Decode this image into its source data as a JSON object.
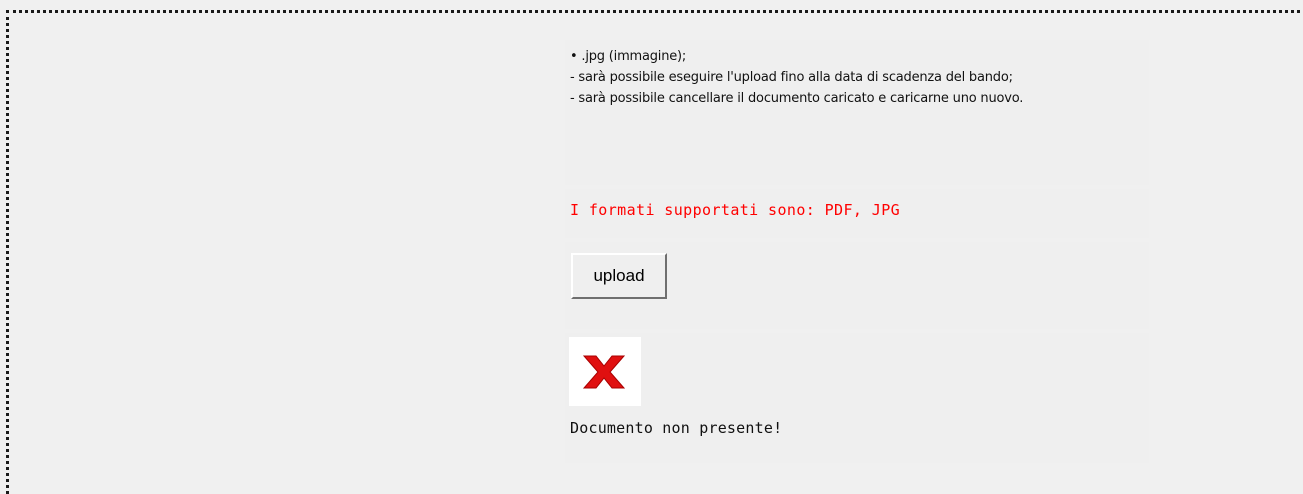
{
  "instructions": {
    "lines": [
      "• .jpg (immagine);",
      "- sarà possibile eseguire l'upload fino alla data di scadenza del bando;",
      "- sarà possibile cancellare il documento caricato e caricarne uno nuovo."
    ]
  },
  "formats": {
    "text": "I formati supportati sono: PDF, JPG",
    "color": "#ff0000"
  },
  "upload": {
    "label": "upload"
  },
  "document_status": {
    "icon": "red-x-icon",
    "icon_color": "#e01010",
    "text": "Documento non presente!"
  }
}
